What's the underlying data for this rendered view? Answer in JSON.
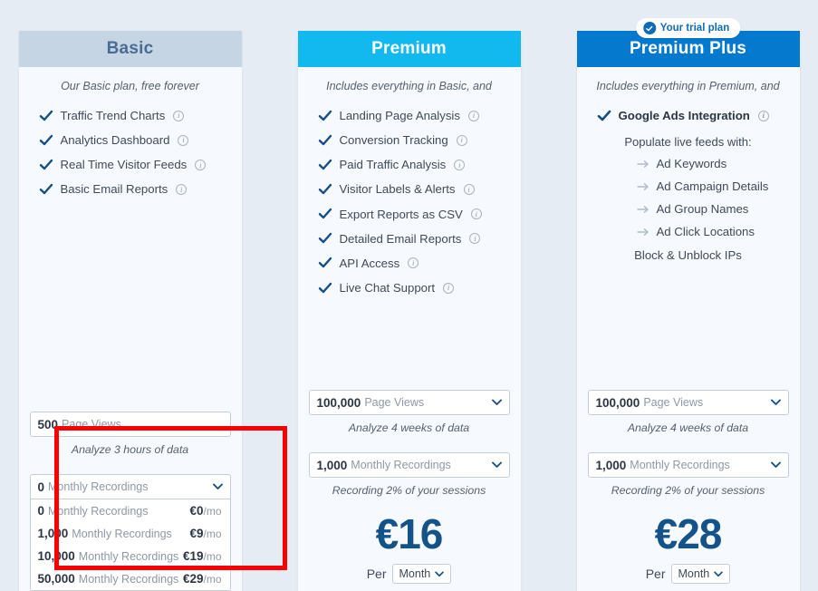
{
  "page": {
    "background_color": "#e6ecf3",
    "accent_dark_blue": "#145389",
    "highlight_color": "#fb0000"
  },
  "plans": [
    {
      "id": "basic",
      "title": "Basic",
      "header_color": "#c6d5e4",
      "tagline": "Our Basic plan, free forever",
      "features": [
        {
          "label": "Traffic Trend Charts",
          "info": "i"
        },
        {
          "label": "Analytics Dashboard",
          "info": "i"
        },
        {
          "label": "Real Time Visitor Feeds",
          "info": "i"
        },
        {
          "label": "Basic Email Reports",
          "info": "i"
        }
      ],
      "page_views": {
        "amount": "500",
        "unit": "Page Views"
      },
      "page_views_note": "Analyze 3 hours of data",
      "recordings_toggle": {
        "amount": "0",
        "unit": "Monthly Recordings"
      },
      "recordings_options": [
        {
          "amount": "0",
          "unit": "Monthly Recordings",
          "cost": "€0",
          "per": "/mo"
        },
        {
          "amount": "1,000",
          "unit": "Monthly Recordings",
          "cost": "€9",
          "per": "/mo"
        },
        {
          "amount": "10,000",
          "unit": "Monthly Recordings",
          "cost": "€19",
          "per": "/mo"
        },
        {
          "amount": "50,000",
          "unit": "Monthly Recordings",
          "cost": "€29",
          "per": "/mo"
        }
      ]
    },
    {
      "id": "premium",
      "title": "Premium",
      "header_color": "#12b9ef",
      "tagline": "Includes everything in Basic, and",
      "features": [
        {
          "label": "Landing Page Analysis",
          "info": "i"
        },
        {
          "label": "Conversion Tracking",
          "info": "i"
        },
        {
          "label": "Paid Traffic Analysis",
          "info": "i"
        },
        {
          "label": "Visitor Labels & Alerts",
          "info": "i"
        },
        {
          "label": "Export Reports as CSV",
          "info": "i"
        },
        {
          "label": "Detailed Email Reports",
          "info": "i"
        },
        {
          "label": "API Access",
          "info": "i"
        },
        {
          "label": "Live Chat Support",
          "info": "i"
        }
      ],
      "page_views": {
        "amount": "100,000",
        "unit": "Page Views"
      },
      "page_views_note": "Analyze 4 weeks of data",
      "recordings": {
        "amount": "1,000",
        "unit": "Monthly Recordings"
      },
      "recordings_note": "Recording 2% of your sessions",
      "price": "€16",
      "per_label": "Per",
      "per_value": "Month"
    },
    {
      "id": "premium-plus",
      "title": "Premium Plus",
      "header_color": "#0579ce",
      "badge": "Your trial plan",
      "tagline": "Includes everything in Premium, and",
      "features": [
        {
          "label": "Google Ads Integration",
          "info": "i",
          "bold": true
        }
      ],
      "sub_heading": "Populate live feeds with:",
      "sub_items": [
        "Ad Keywords",
        "Ad Campaign Details",
        "Ad Group Names",
        "Ad Click Locations"
      ],
      "extra_line": "Block & Unblock IPs",
      "page_views": {
        "amount": "100,000",
        "unit": "Page Views"
      },
      "page_views_note": "Analyze 4 weeks of data",
      "recordings": {
        "amount": "1,000",
        "unit": "Monthly Recordings"
      },
      "recordings_note": "Recording 2% of your sessions",
      "price": "€28",
      "per_label": "Per",
      "per_value": "Month"
    }
  ]
}
